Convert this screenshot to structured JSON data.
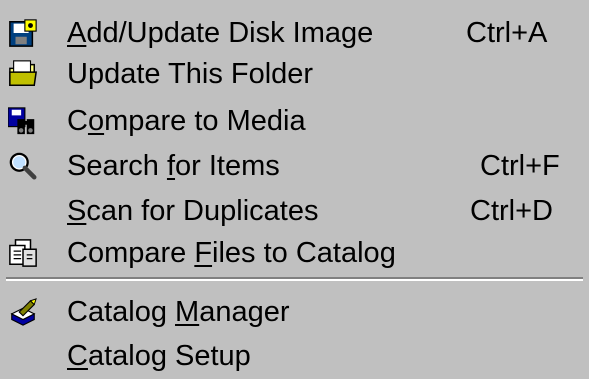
{
  "menu": {
    "items": [
      {
        "pre": "",
        "acc": "A",
        "post": "dd/Update Disk Image",
        "shortcut": "Ctrl+A",
        "icon": "disk-image-icon"
      },
      {
        "pre": "Update This Folder",
        "acc": "",
        "post": "",
        "shortcut": "",
        "icon": "folder-update-icon"
      },
      {
        "pre": "C",
        "acc": "o",
        "post": "mpare to Media",
        "shortcut": "",
        "icon": "compare-media-icon"
      },
      {
        "pre": "Search ",
        "acc": "f",
        "post": "or Items",
        "shortcut": "Ctrl+F",
        "icon": "search-icon"
      },
      {
        "pre": "",
        "acc": "S",
        "post": "can for Duplicates",
        "shortcut": "Ctrl+D",
        "icon": ""
      },
      {
        "pre": "Compare ",
        "acc": "F",
        "post": "iles to Catalog",
        "shortcut": "",
        "icon": "compare-files-icon"
      },
      {
        "pre": "Catalog ",
        "acc": "M",
        "post": "anager",
        "shortcut": "",
        "icon": "catalog-manager-icon"
      },
      {
        "pre": "",
        "acc": "C",
        "post": "atalog Setup",
        "shortcut": "",
        "icon": ""
      }
    ]
  }
}
